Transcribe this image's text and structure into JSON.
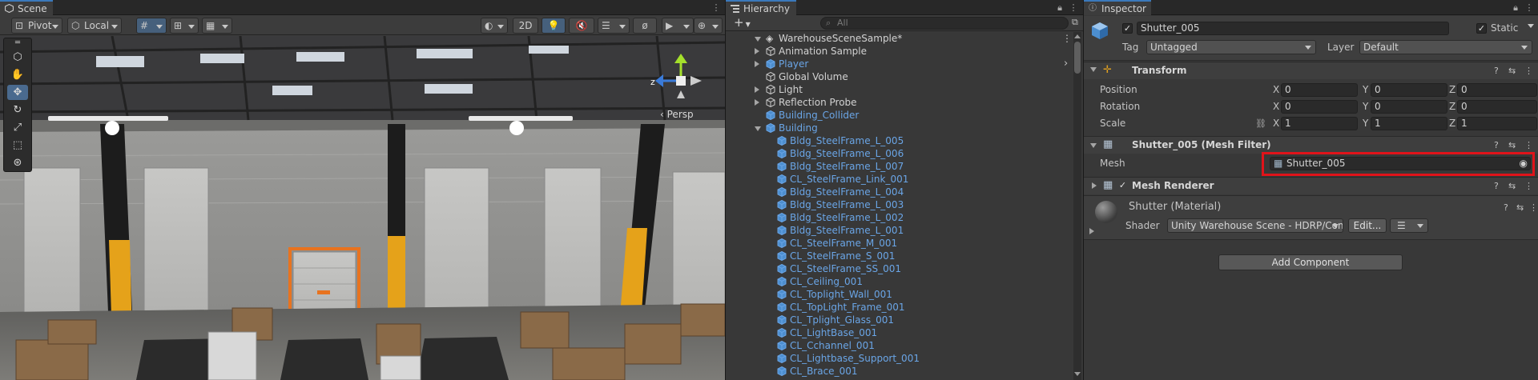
{
  "scene": {
    "tab_label": "Scene",
    "pivot_label": "Pivot",
    "local_label": "Local",
    "two_d_label": "2D",
    "persp_label": "Persp",
    "axis_z_label": "z"
  },
  "hierarchy": {
    "tab_label": "Hierarchy",
    "search_placeholder": "All",
    "add_label": "+",
    "root": "WarehouseSceneSample*",
    "items": [
      {
        "label": "Animation Sample",
        "indent": 1,
        "arrow": "right",
        "color": "white"
      },
      {
        "label": "Player",
        "indent": 1,
        "arrow": "right",
        "color": "blue"
      },
      {
        "label": "Global Volume",
        "indent": 1,
        "arrow": "none",
        "color": "white"
      },
      {
        "label": "Light",
        "indent": 1,
        "arrow": "right",
        "color": "white"
      },
      {
        "label": "Reflection Probe",
        "indent": 1,
        "arrow": "right",
        "color": "white"
      },
      {
        "label": "Building_Collider",
        "indent": 1,
        "arrow": "none",
        "color": "blue"
      },
      {
        "label": "Building",
        "indent": 1,
        "arrow": "down",
        "color": "blue"
      },
      {
        "label": "Bldg_SteelFrame_L_005",
        "indent": 2,
        "arrow": "none",
        "color": "blue"
      },
      {
        "label": "Bldg_SteelFrame_L_006",
        "indent": 2,
        "arrow": "none",
        "color": "blue"
      },
      {
        "label": "Bldg_SteelFrame_L_007",
        "indent": 2,
        "arrow": "none",
        "color": "blue"
      },
      {
        "label": "CL_SteelFrame_Link_001",
        "indent": 2,
        "arrow": "none",
        "color": "blue"
      },
      {
        "label": "Bldg_SteelFrame_L_004",
        "indent": 2,
        "arrow": "none",
        "color": "blue"
      },
      {
        "label": "Bldg_SteelFrame_L_003",
        "indent": 2,
        "arrow": "none",
        "color": "blue"
      },
      {
        "label": "Bldg_SteelFrame_L_002",
        "indent": 2,
        "arrow": "none",
        "color": "blue"
      },
      {
        "label": "Bldg_SteelFrame_L_001",
        "indent": 2,
        "arrow": "none",
        "color": "blue"
      },
      {
        "label": "CL_SteelFrame_M_001",
        "indent": 2,
        "arrow": "none",
        "color": "blue"
      },
      {
        "label": "CL_SteelFrame_S_001",
        "indent": 2,
        "arrow": "none",
        "color": "blue"
      },
      {
        "label": "CL_SteelFrame_SS_001",
        "indent": 2,
        "arrow": "none",
        "color": "blue"
      },
      {
        "label": "CL_Ceiling_001",
        "indent": 2,
        "arrow": "none",
        "color": "blue"
      },
      {
        "label": "CL_Toplight_Wall_001",
        "indent": 2,
        "arrow": "none",
        "color": "blue"
      },
      {
        "label": "CL_TopLight_Frame_001",
        "indent": 2,
        "arrow": "none",
        "color": "blue"
      },
      {
        "label": "CL_Tplight_Glass_001",
        "indent": 2,
        "arrow": "none",
        "color": "blue"
      },
      {
        "label": "CL_LightBase_001",
        "indent": 2,
        "arrow": "none",
        "color": "blue"
      },
      {
        "label": "CL_Cchannel_001",
        "indent": 2,
        "arrow": "none",
        "color": "blue"
      },
      {
        "label": "CL_Lightbase_Support_001",
        "indent": 2,
        "arrow": "none",
        "color": "blue"
      },
      {
        "label": "CL_Brace_001",
        "indent": 2,
        "arrow": "none",
        "color": "blue"
      }
    ]
  },
  "inspector": {
    "tab_label": "Inspector",
    "object_name": "Shutter_005",
    "static_label": "Static",
    "tag_label": "Tag",
    "tag_value": "Untagged",
    "layer_label": "Layer",
    "layer_value": "Default",
    "transform": {
      "title": "Transform",
      "rows": [
        {
          "label": "Position",
          "x": "0",
          "y": "0",
          "z": "0"
        },
        {
          "label": "Rotation",
          "x": "0",
          "y": "0",
          "z": "0"
        },
        {
          "label": "Scale",
          "x": "1",
          "y": "1",
          "z": "1"
        }
      ],
      "axis_x": "X",
      "axis_y": "Y",
      "axis_z": "Z"
    },
    "mesh_filter": {
      "title": "Shutter_005 (Mesh Filter)",
      "mesh_label": "Mesh",
      "mesh_value": "Shutter_005"
    },
    "mesh_renderer": {
      "title": "Mesh Renderer"
    },
    "material": {
      "title": "Shutter (Material)",
      "shader_label": "Shader",
      "shader_value": "Unity Warehouse Scene - HDRP/Common_AlbedoSmoothness",
      "edit_label": "Edit..."
    },
    "add_component_label": "Add Component"
  },
  "colors": {
    "highlight": "#e0131a",
    "selection_blue": "#4a6a8e",
    "name_blue": "#6aa5e6"
  }
}
